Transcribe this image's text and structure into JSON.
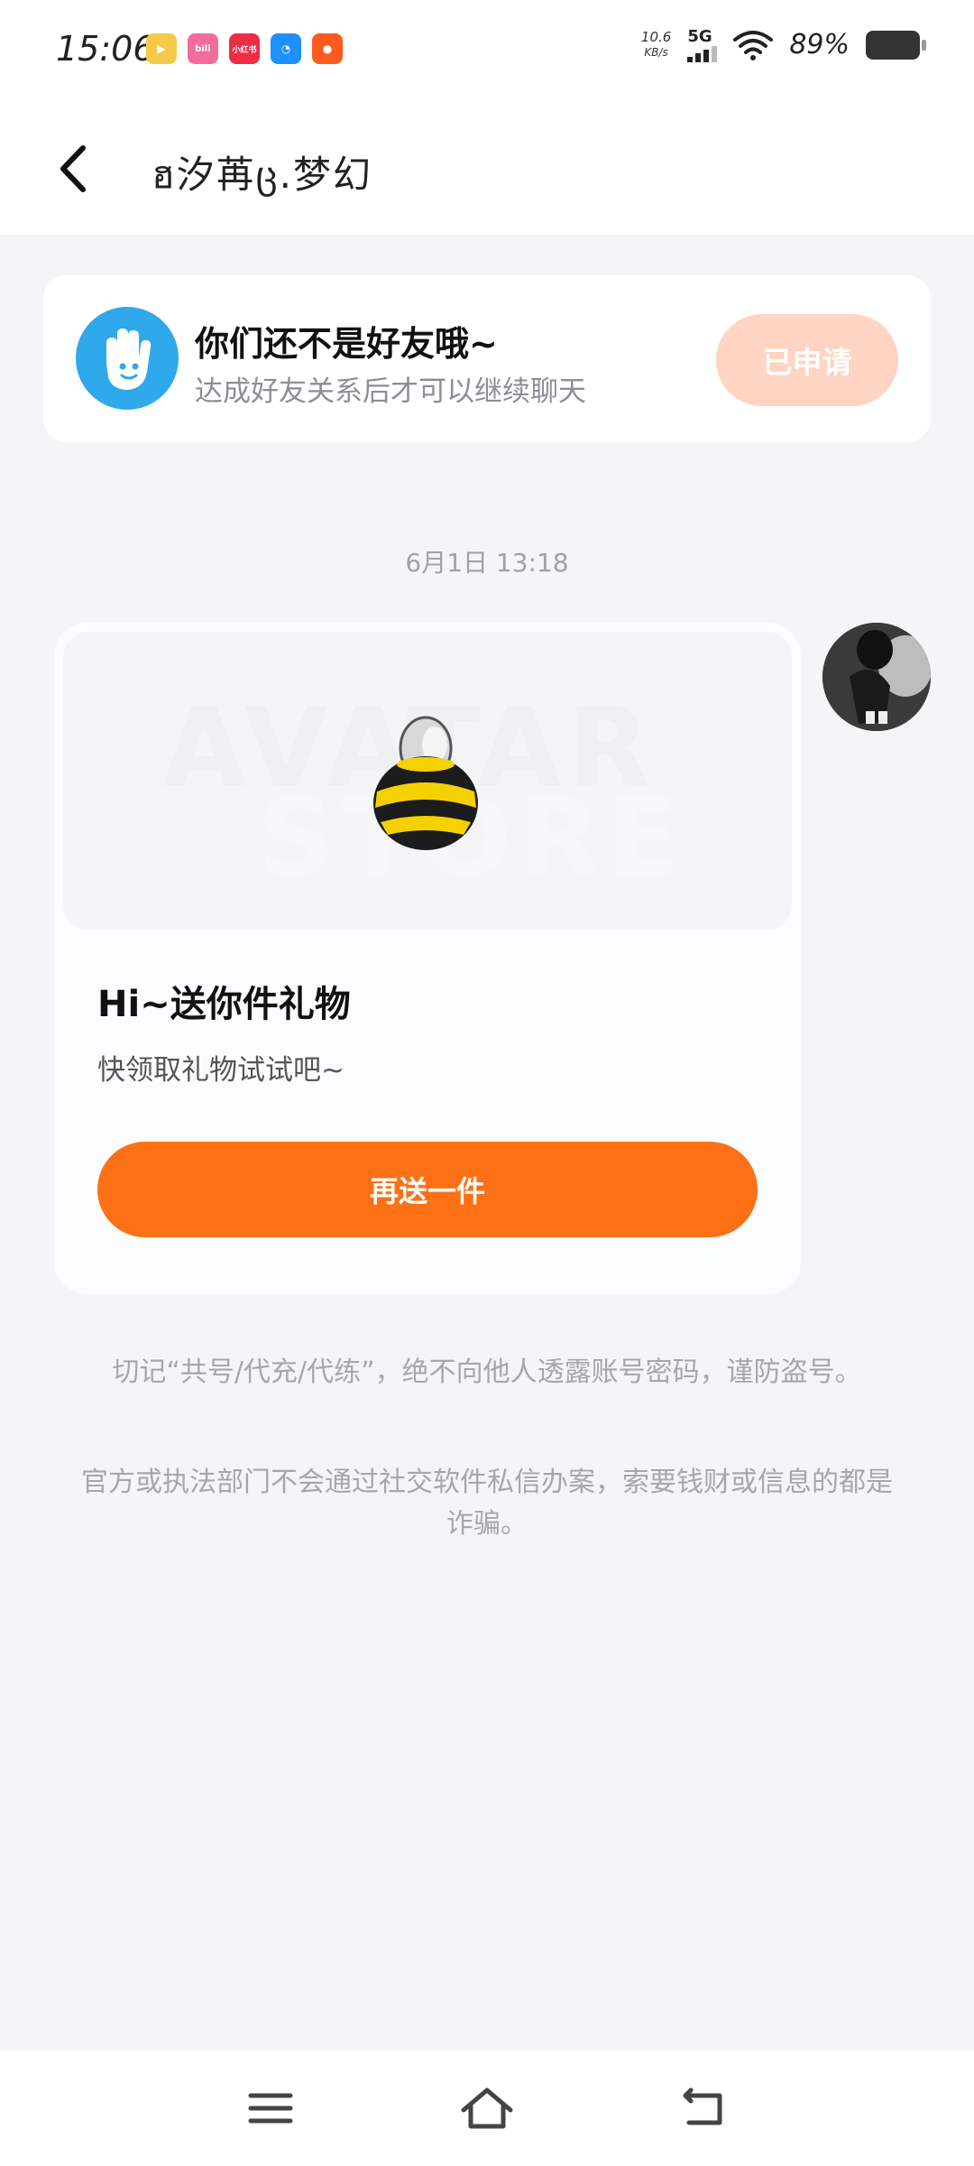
{
  "status_bar": {
    "time": "15:06",
    "net_speed_value": "10.6",
    "net_speed_unit": "KB/s",
    "network": "5G",
    "battery": "89%",
    "app_icons": [
      {
        "name": "tencent-video-icon",
        "label": "▶",
        "color": "#f7c948"
      },
      {
        "name": "bilibili-icon",
        "label": "bili",
        "color": "#f06d9c"
      },
      {
        "name": "xiaohongshu-icon",
        "label": "小红书",
        "color": "#ef2c45"
      },
      {
        "name": "browser-icon",
        "label": "◔",
        "color": "#1e90ff"
      },
      {
        "name": "kuaishou-icon",
        "label": "●",
        "color": "#fe5a1d"
      }
    ]
  },
  "header": {
    "title": "ฮ汐苒ც.梦幻"
  },
  "friend_banner": {
    "title": "你们还不是好友哦~",
    "subtitle": "达成好友关系后才可以继续聊天",
    "button_label": "已申请"
  },
  "chat": {
    "timestamp": "6月1日 13:18",
    "gift_card": {
      "watermark_line1": "AVATAR",
      "watermark_line2": "STORE",
      "title": "Hi~送你件礼物",
      "subtitle": "快领取礼物试试吧~",
      "button_label": "再送一件"
    }
  },
  "warnings": [
    "切记“共号/代充/代练”，绝不向他人透露账号密码，谨防盗号。",
    "官方或执法部门不会通过社交软件私信办案，索要钱财或信息的都是诈骗。"
  ],
  "colors": {
    "accent": "#fd7016",
    "applied_button": "#fdd5c2",
    "background": "#f3f5f7"
  }
}
